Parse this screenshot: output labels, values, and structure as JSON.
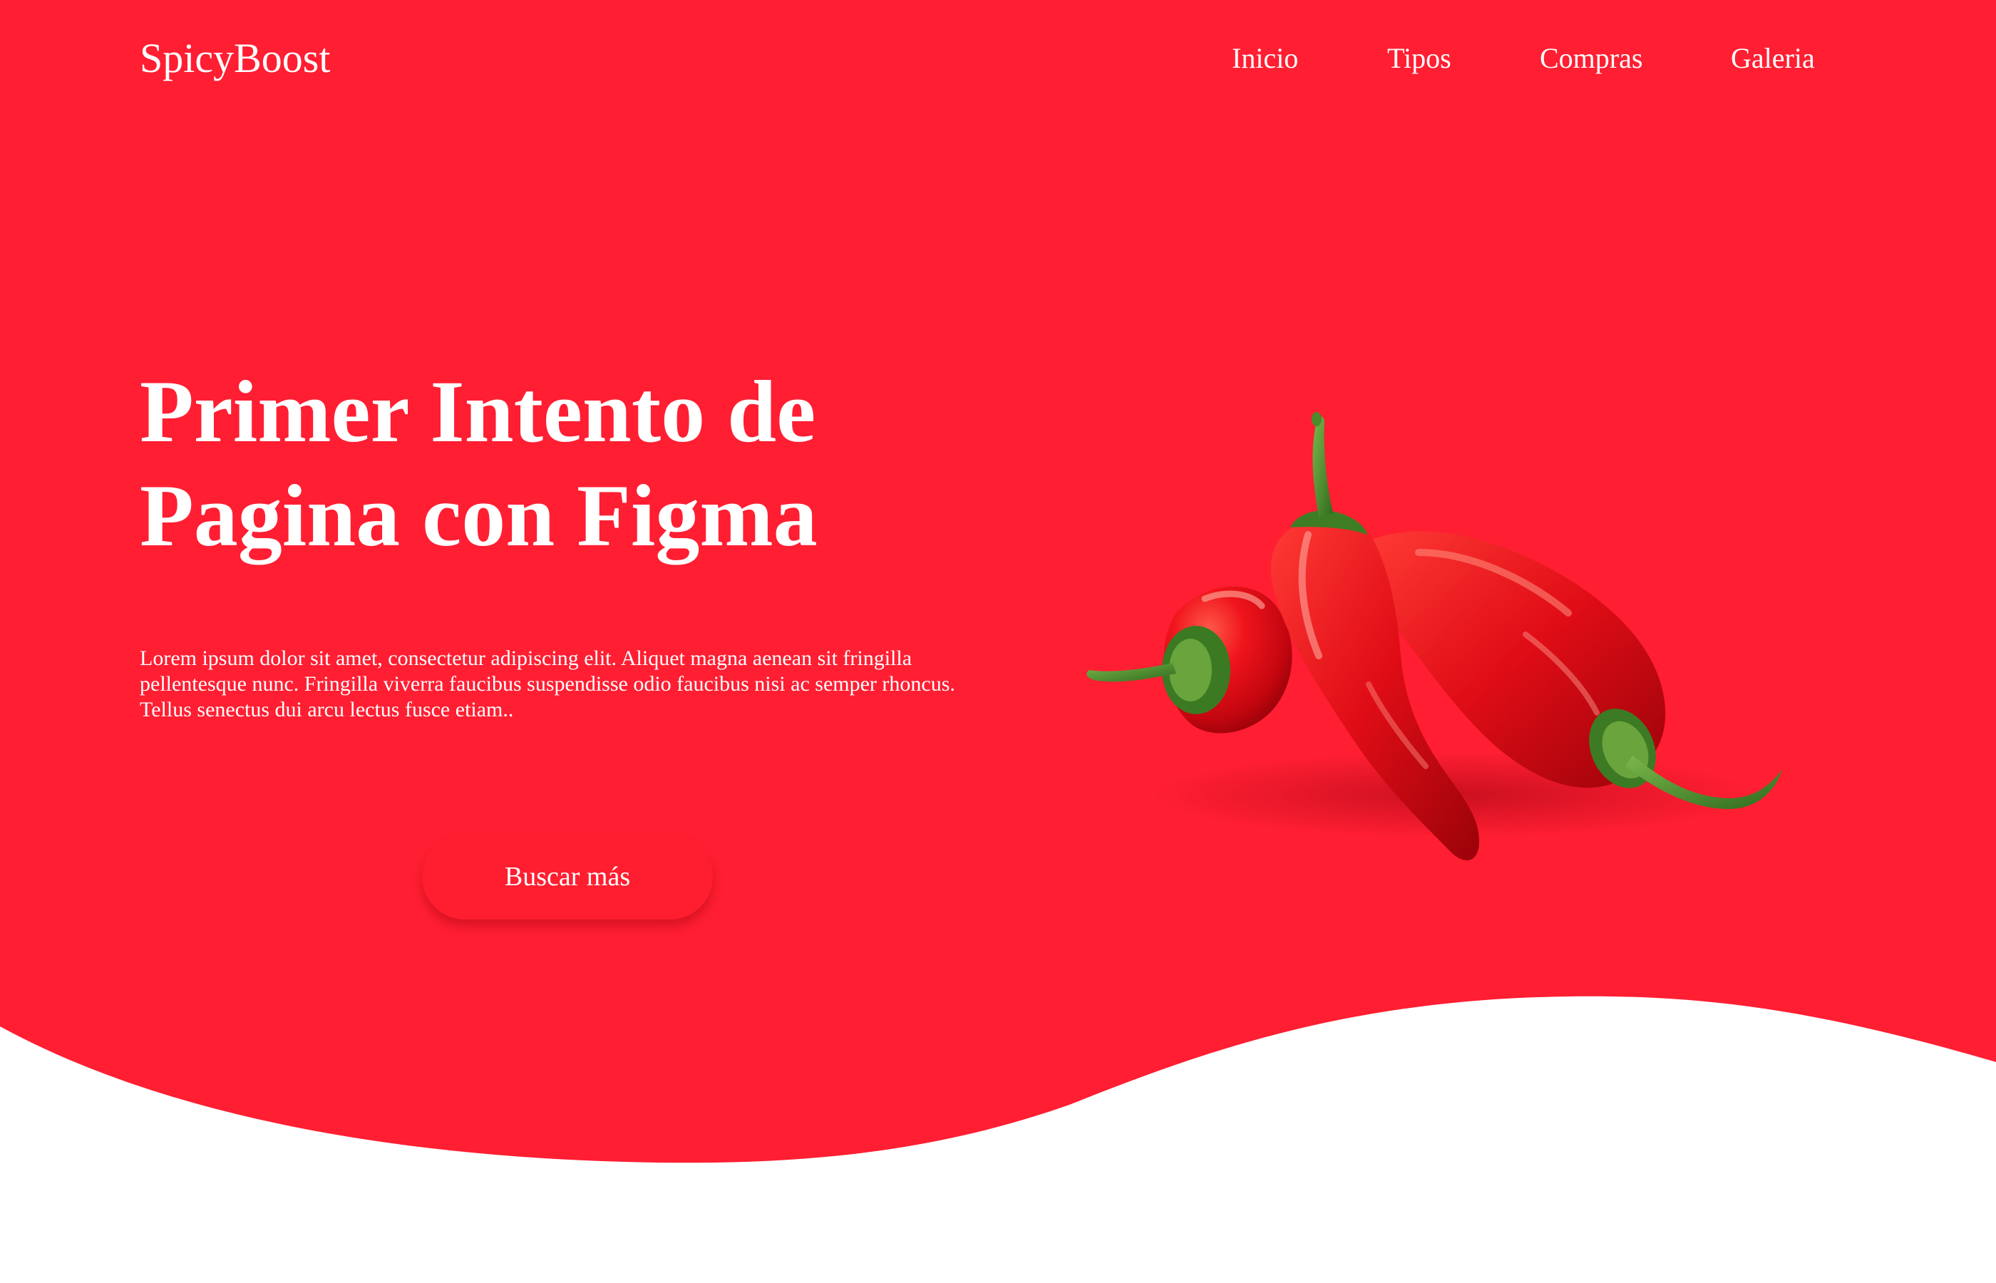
{
  "brand": {
    "name": "SpicyBoost",
    "primary_color": "#ff1e32",
    "text_color": "#ffffff"
  },
  "nav": {
    "items": [
      {
        "label": "Inicio"
      },
      {
        "label": "Tipos"
      },
      {
        "label": "Compras"
      },
      {
        "label": "Galeria"
      }
    ]
  },
  "hero": {
    "headline_line1": "Primer Intento de",
    "headline_line2": "Pagina con Figma",
    "description": "Lorem ipsum dolor sit amet, consectetur adipiscing elit. Aliquet magna aenean sit fringilla pellentesque nunc. Fringilla viverra faucibus suspendisse odio faucibus nisi ac semper rhoncus. Tellus senectus dui arcu lectus fusce etiam..",
    "cta_label": "Buscar más",
    "image": "red-chili-peppers"
  }
}
